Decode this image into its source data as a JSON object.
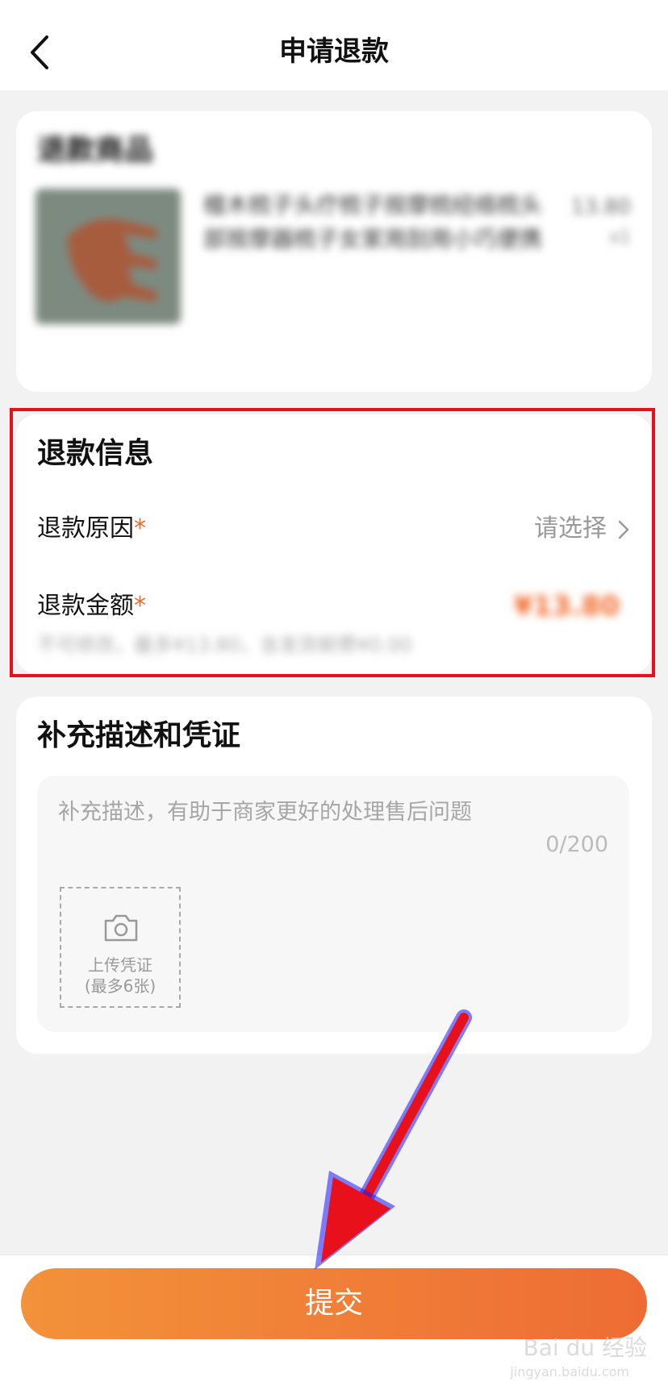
{
  "header": {
    "title": "申请退款",
    "back_icon": "chevron-left-icon"
  },
  "goods": {
    "section_title": "退款商品",
    "name": "檀木梳子头疗梳子按摩梳经络梳头部按摩器梳子女家用刮用小巧便携",
    "price": "13.80",
    "quantity": "x1"
  },
  "refund_info": {
    "section_title": "退款信息",
    "reason_label": "退款原因",
    "reason_placeholder": "请选择",
    "amount_label": "退款金额",
    "amount_value": "¥13.80",
    "amount_note": "不可修改，最多¥13.80，含发货邮费¥0.00",
    "required_mark": "*"
  },
  "description": {
    "section_title": "补充描述和凭证",
    "placeholder": "补充描述，有助于商家更好的处理售后问题",
    "counter": "0/200",
    "upload_label": "上传凭证",
    "upload_limit": "(最多6张)"
  },
  "footer": {
    "submit_label": "提交"
  },
  "watermark": {
    "text": "Bai du 经验",
    "sub": "jingyan.baidu.com"
  },
  "colors": {
    "accent": "#f06a2c",
    "highlight_box": "#e8101a",
    "annotation_arrow": "#e8101a",
    "button_gradient_start": "#f2923a",
    "button_gradient_end": "#ee6c34"
  }
}
